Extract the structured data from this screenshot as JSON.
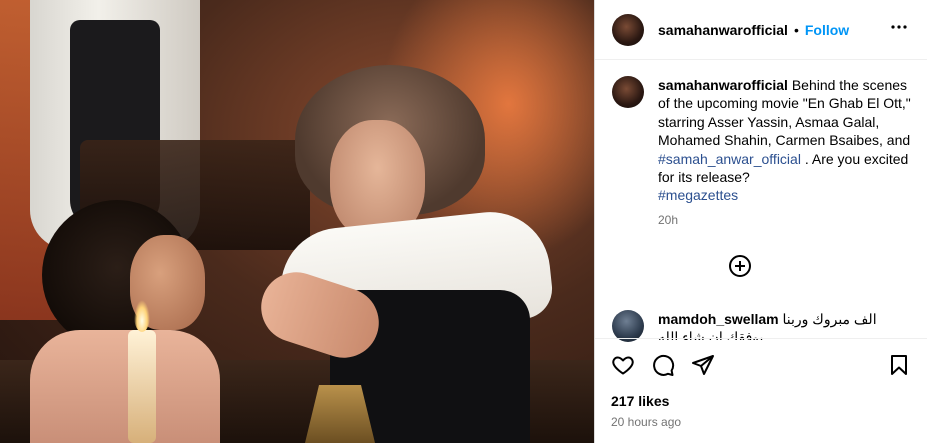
{
  "post": {
    "username": "samahanwarofficial",
    "dot": "•",
    "follow_label": "Follow",
    "more_label": "•••",
    "caption": {
      "text_part1": "Behind the scenes of the upcoming movie \"En Ghab El Ott,\" starring Asser Yassin, Asmaa Galal, Mohamed Shahin, Carmen Bsaibes, and",
      "hashtag1": "#samah_anwar_official",
      "text_part2": ". Are you excited for its release?",
      "hashtag2": "#megazettes",
      "time": "20h"
    },
    "comment": {
      "username": "mamdoh_swellam",
      "text": "الف مبروك وربنا يوفقك ان شاء الله"
    },
    "likes": "217 likes",
    "posted_ago": "20 hours ago"
  },
  "icons": {
    "more": "more-options-icon",
    "add_comment": "plus-circle-icon",
    "like": "heart-icon",
    "comment": "speech-bubble-icon",
    "share": "paper-plane-icon",
    "save": "bookmark-icon"
  },
  "colors": {
    "follow": "#0095f6",
    "hashtag": "#2b4f8f",
    "muted": "#737373",
    "border": "#dbdbdb"
  }
}
